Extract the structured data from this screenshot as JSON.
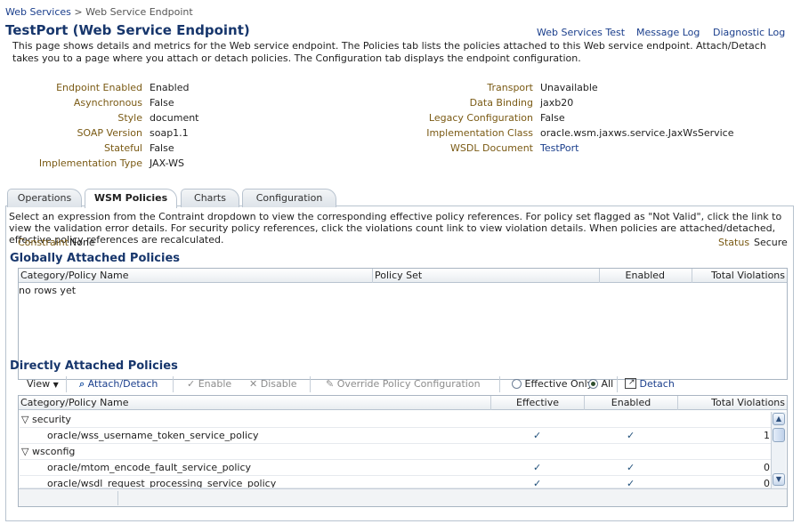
{
  "breadcrumb": {
    "parent": "Web Services",
    "sep": ">",
    "current": "Web Service Endpoint"
  },
  "page": {
    "title": "TestPort (Web Service Endpoint)",
    "description": "This page shows details and metrics for the Web service endpoint. The Policies tab lists the policies attached to this Web service endpoint. Attach/Detach takes you to a page where you attach or detach policies. The Configuration tab displays the endpoint configuration."
  },
  "top_links": {
    "test": "Web Services Test",
    "message_log": "Message Log",
    "diagnostic_log": "Diagnostic Log"
  },
  "props_left": [
    {
      "label": "Endpoint Enabled",
      "value": "Enabled"
    },
    {
      "label": "Asynchronous",
      "value": "False"
    },
    {
      "label": "Style",
      "value": "document"
    },
    {
      "label": "SOAP Version",
      "value": "soap1.1"
    },
    {
      "label": "Stateful",
      "value": "False"
    },
    {
      "label": "Implementation Type",
      "value": "JAX-WS"
    }
  ],
  "props_right": [
    {
      "label": "Transport",
      "value": "Unavailable"
    },
    {
      "label": "Data Binding",
      "value": "jaxb20"
    },
    {
      "label": "Legacy Configuration",
      "value": "False"
    },
    {
      "label": "Implementation Class",
      "value": "oracle.wsm.jaxws.service.JaxWsService"
    },
    {
      "label": "WSDL Document",
      "value": "TestPort"
    }
  ],
  "tabs": {
    "operations": "Operations",
    "wsm_policies": "WSM Policies",
    "charts": "Charts",
    "configuration": "Configuration"
  },
  "policies_tab": {
    "description": "Select an expression from the Contraint dropdown to view the corresponding effective policy references. For policy set flagged as \"Not Valid\", click the link to view the validation error details. For security policy references, click the violations count link to view violation details. When policies are attached/detached, effective policy references are recalculated.",
    "constraint_label": "Constraint",
    "constraint_value": "None",
    "status_label": "Status",
    "status_value": "Secure"
  },
  "global_section": {
    "title": "Globally Attached Policies",
    "columns": {
      "name": "Category/Policy Name",
      "policy_set": "Policy Set",
      "enabled": "Enabled",
      "violations": "Total Violations"
    },
    "empty_text": "no rows yet"
  },
  "direct_section": {
    "title": "Directly Attached Policies",
    "toolbar": {
      "view": "View",
      "attach_detach": "Attach/Detach",
      "enable": "Enable",
      "disable": "Disable",
      "override": "Override Policy Configuration",
      "effective_only": "Effective Only",
      "all": "All",
      "detach": "Detach"
    },
    "columns": {
      "name": "Category/Policy Name",
      "effective": "Effective",
      "enabled": "Enabled",
      "violations": "Total Violations"
    },
    "rows": [
      {
        "type": "category",
        "name": "security"
      },
      {
        "type": "policy",
        "name": "oracle/wss_username_token_service_policy",
        "effective": "✓",
        "enabled": "✓",
        "violations": "1"
      },
      {
        "type": "category",
        "name": "wsconfig"
      },
      {
        "type": "policy",
        "name": "oracle/mtom_encode_fault_service_policy",
        "effective": "✓",
        "enabled": "✓",
        "violations": "0"
      },
      {
        "type": "policy",
        "name": "oracle/wsdl_request_processing_service_policy",
        "effective": "✓",
        "enabled": "✓",
        "violations": "0"
      }
    ]
  },
  "colors": {
    "title": "#17366c",
    "link": "#1a3e8c",
    "label": "#7a5a14",
    "border": "#b8c3cf"
  }
}
